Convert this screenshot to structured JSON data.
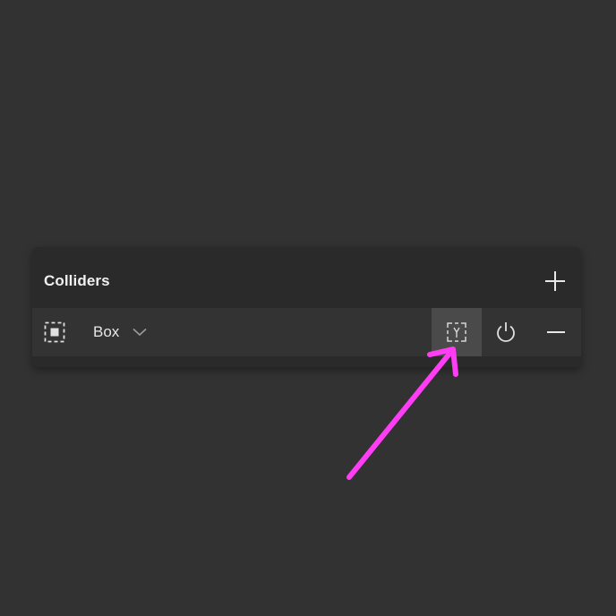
{
  "panel": {
    "title": "Colliders",
    "add_icon": "plus-icon"
  },
  "collider_row": {
    "shape_icon": "box-collider-icon",
    "type_value": "Box",
    "dropdown_icon": "chevron-down-icon",
    "edit_icon": "edit-collider-icon",
    "power_icon": "power-icon",
    "remove_icon": "minus-icon"
  },
  "annotation": {
    "arrow_color": "#ff3df5"
  },
  "colors": {
    "background": "#323232",
    "panel": "#2a2a2a",
    "row": "#333333",
    "active_button": "#4a4a4a",
    "text": "#e6e6e6"
  }
}
